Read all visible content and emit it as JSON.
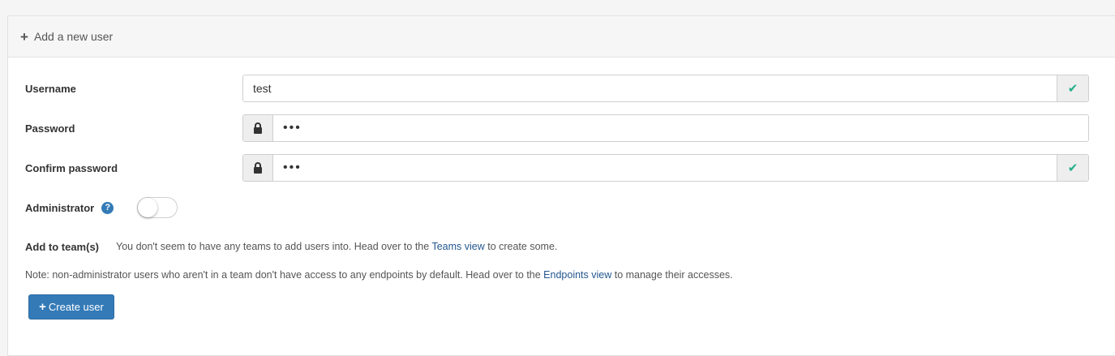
{
  "header": {
    "icon": "plus-icon",
    "title": "Add a new user"
  },
  "form": {
    "username": {
      "label": "Username",
      "value": "test",
      "status_icon": "check-icon"
    },
    "password": {
      "label": "Password",
      "value": "•••",
      "icon": "lock-icon"
    },
    "confirm_password": {
      "label": "Confirm password",
      "value": "•••",
      "icon": "lock-icon",
      "status_icon": "check-icon"
    },
    "administrator": {
      "label": "Administrator",
      "help_icon_text": "?",
      "enabled": false
    },
    "teams": {
      "label": "Add to team(s)",
      "text_before": "You don't seem to have any teams to add users into. Head over to the ",
      "link": "Teams view",
      "text_after": " to create some."
    },
    "note": {
      "text_before": "Note: non-administrator users who aren't in a team don't have access to any endpoints by default. Head over to the ",
      "link": "Endpoints view",
      "text_after": " to manage their accesses."
    },
    "submit": {
      "icon": "plus-icon",
      "label": "Create user"
    }
  },
  "colors": {
    "primary": "#337ab7",
    "success": "#23ae89",
    "link": "#23578f"
  }
}
